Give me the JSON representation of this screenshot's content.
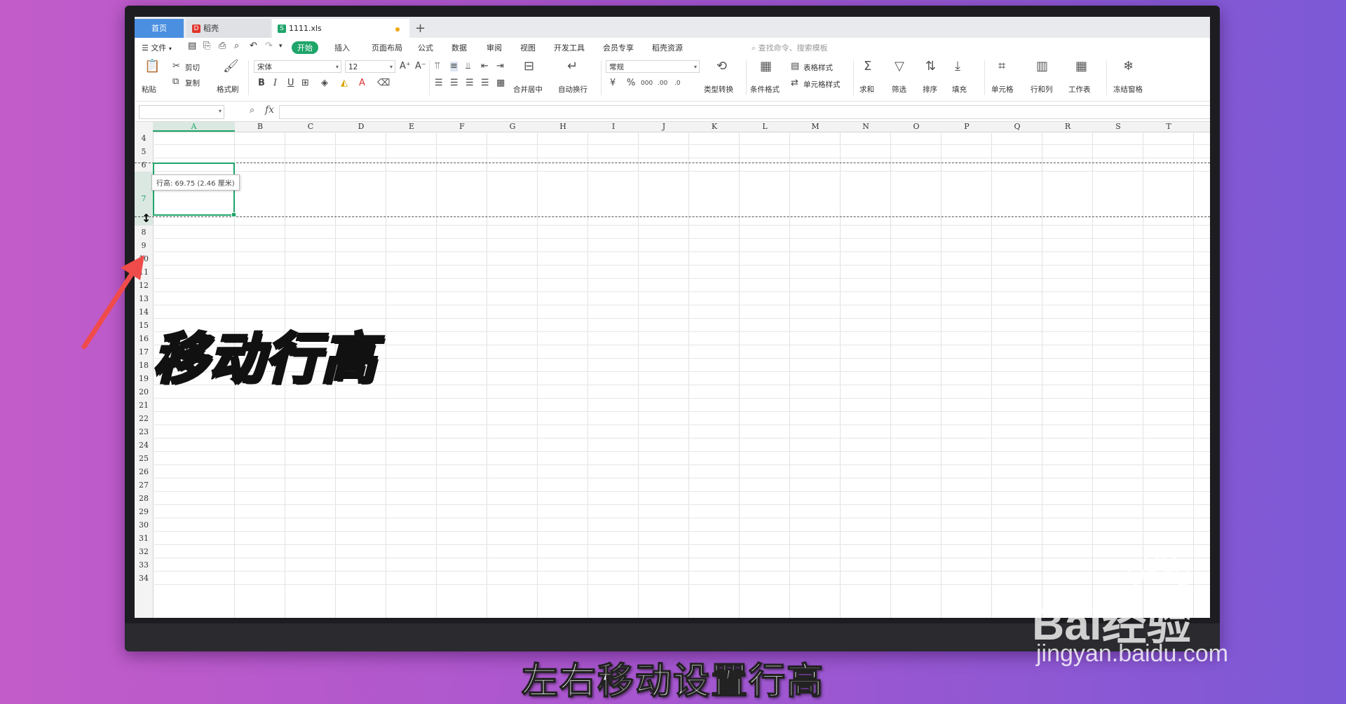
{
  "tabs": {
    "home": "首页",
    "daoke": "稻壳",
    "file": "1111.xls",
    "add": "+"
  },
  "menu": {
    "file": "文件",
    "start": "开始",
    "insert": "插入",
    "page_layout": "页面布局",
    "formula": "公式",
    "data": "数据",
    "review": "审阅",
    "view": "视图",
    "dev_tools": "开发工具",
    "member": "会员专享",
    "daoke_res": "稻壳资源",
    "search_placeholder": "查找命令、搜索模板"
  },
  "toolbar": {
    "paste": "粘贴",
    "cut": "剪切",
    "copy": "复制",
    "format_painter": "格式刷",
    "font_name": "宋体",
    "font_size": "12",
    "merge_center": "合并居中",
    "wrap_text": "自动换行",
    "number_format": "常规",
    "type_convert": "类型转换",
    "cond_format": "条件格式",
    "table_style": "表格样式",
    "cell_style": "单元格样式",
    "sum": "求和",
    "filter": "筛选",
    "sort": "排序",
    "fill": "填充",
    "cell": "单元格",
    "row_col": "行和列",
    "worksheet": "工作表",
    "freeze": "冻结窗格"
  },
  "formula_bar": {
    "fx": "fx"
  },
  "grid": {
    "columns": [
      "A",
      "B",
      "C",
      "D",
      "E",
      "F",
      "G",
      "H",
      "I",
      "J",
      "K",
      "L",
      "M",
      "N",
      "O",
      "P",
      "Q",
      "R",
      "S",
      "T"
    ],
    "rows": [
      "4",
      "5",
      "6",
      "7",
      "8",
      "9",
      "10",
      "11",
      "12",
      "13",
      "14",
      "15",
      "16",
      "17",
      "18",
      "19",
      "20",
      "21",
      "22",
      "23",
      "24",
      "25",
      "26",
      "27",
      "28",
      "29",
      "30",
      "31",
      "32",
      "33",
      "34"
    ],
    "selected_column": "A",
    "selected_row": "7",
    "tooltip": "行高: 69.75 (2.46 厘米)"
  },
  "overlay": {
    "caption": "移动行高",
    "subtitle": "左右移动设置行高",
    "watermark_brand": "Bai经验",
    "watermark_url": "jingyan.baidu.com"
  },
  "colors": {
    "accent_green": "#1ea56a",
    "tab_blue": "#4a8fe0",
    "arrow_red": "#f04b4b"
  }
}
